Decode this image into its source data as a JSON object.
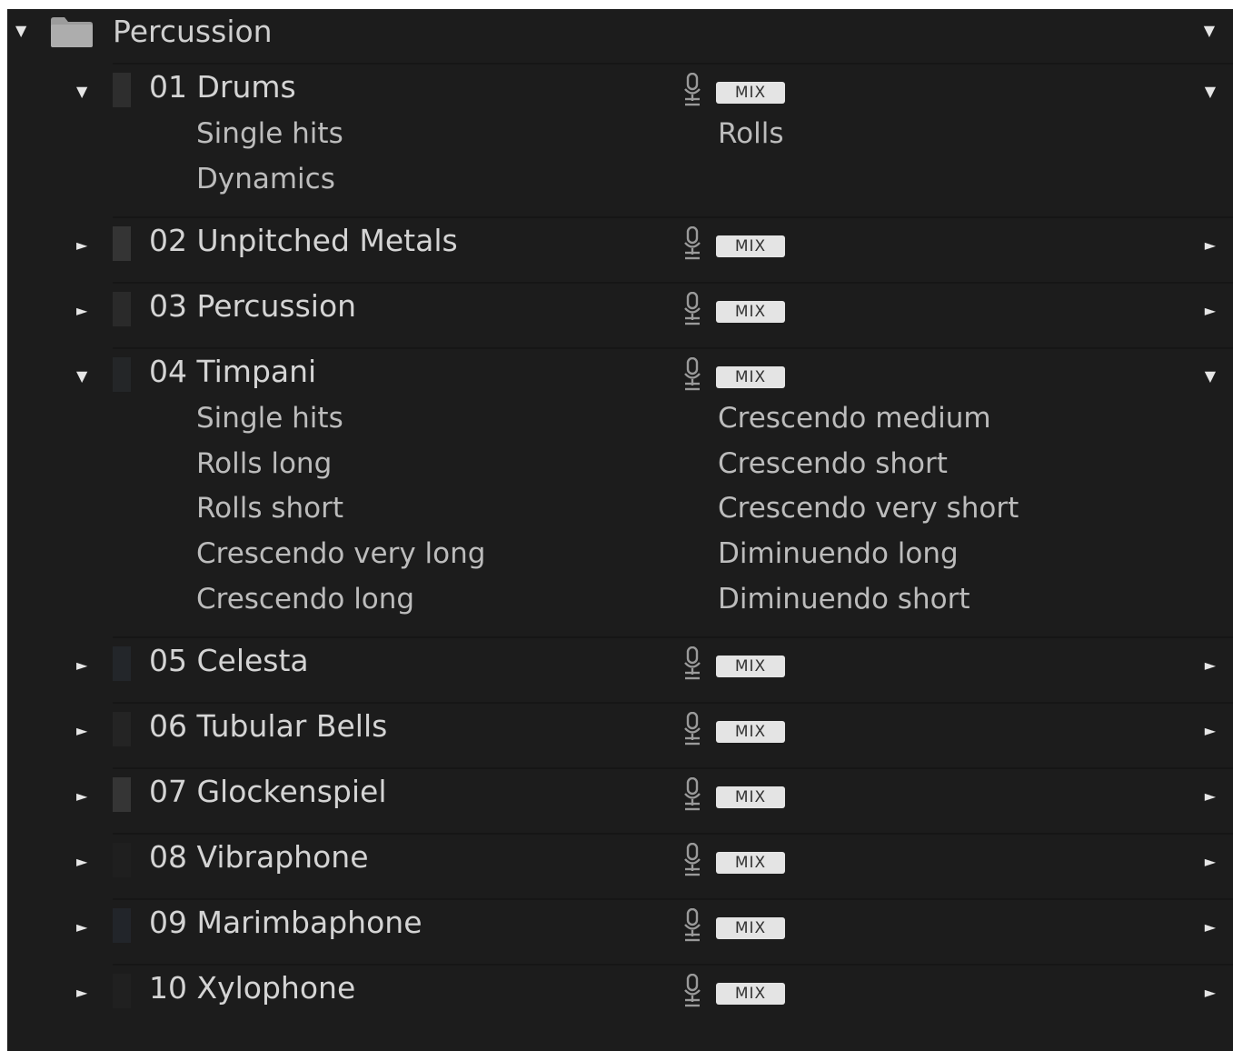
{
  "folder": {
    "title": "Percussion",
    "expand_glyph": "▼",
    "menu_glyph": "▼",
    "icon": "folder-icon"
  },
  "colors": {
    "panel_bg": "#1c1c1c",
    "text": "#d4d4d4",
    "articulation_text": "#bcbcbc",
    "badge_bg": "#e4e4e4"
  },
  "instruments": [
    {
      "name": "01  Drums",
      "expanded": true,
      "mix_label": "MIX",
      "disc_left": "▼",
      "disc_right": "▼",
      "bar_color": "#2e2e2e",
      "mic_icon": "microphone-icon",
      "articulations_left": [
        "Single hits",
        "Dynamics"
      ],
      "articulations_right": [
        "Rolls"
      ]
    },
    {
      "name": "02 Unpitched Metals",
      "expanded": false,
      "mix_label": "MIX",
      "disc_left": "►",
      "disc_right": "►",
      "bar_color": "#343434",
      "mic_icon": "microphone-icon"
    },
    {
      "name": "03 Percussion",
      "expanded": false,
      "mix_label": "MIX",
      "disc_left": "►",
      "disc_right": "►",
      "bar_color": "#2a2a2a",
      "mic_icon": "microphone-icon"
    },
    {
      "name": "04 Timpani",
      "expanded": true,
      "mix_label": "MIX",
      "disc_left": "▼",
      "disc_right": "▼",
      "bar_color": "#242628",
      "mic_icon": "microphone-icon",
      "articulations_left": [
        "Single hits",
        "Rolls long",
        "Rolls short",
        "Crescendo very long",
        "Crescendo long"
      ],
      "articulations_right": [
        "Crescendo medium",
        "Crescendo short",
        "Crescendo very short",
        "Diminuendo long",
        "Diminuendo short"
      ]
    },
    {
      "name": "05 Celesta",
      "expanded": false,
      "mix_label": "MIX",
      "disc_left": "►",
      "disc_right": "►",
      "bar_color": "#23262a",
      "mic_icon": "microphone-icon"
    },
    {
      "name": "06 Tubular Bells",
      "expanded": false,
      "mix_label": "MIX",
      "disc_left": "►",
      "disc_right": "►",
      "bar_color": "#242424",
      "mic_icon": "microphone-icon"
    },
    {
      "name": "07 Glockenspiel",
      "expanded": false,
      "mix_label": "MIX",
      "disc_left": "►",
      "disc_right": "►",
      "bar_color": "#353535",
      "mic_icon": "microphone-icon"
    },
    {
      "name": "08 Vibraphone",
      "expanded": false,
      "mix_label": "MIX",
      "disc_left": "►",
      "disc_right": "►",
      "bar_color": "#1f1f1f",
      "mic_icon": "microphone-icon"
    },
    {
      "name": "09 Marimbaphone",
      "expanded": false,
      "mix_label": "MIX",
      "disc_left": "►",
      "disc_right": "►",
      "bar_color": "#22252a",
      "mic_icon": "microphone-icon"
    },
    {
      "name": "10  Xylophone",
      "expanded": false,
      "mix_label": "MIX",
      "disc_left": "►",
      "disc_right": "►",
      "bar_color": "#202020",
      "mic_icon": "microphone-icon"
    }
  ]
}
